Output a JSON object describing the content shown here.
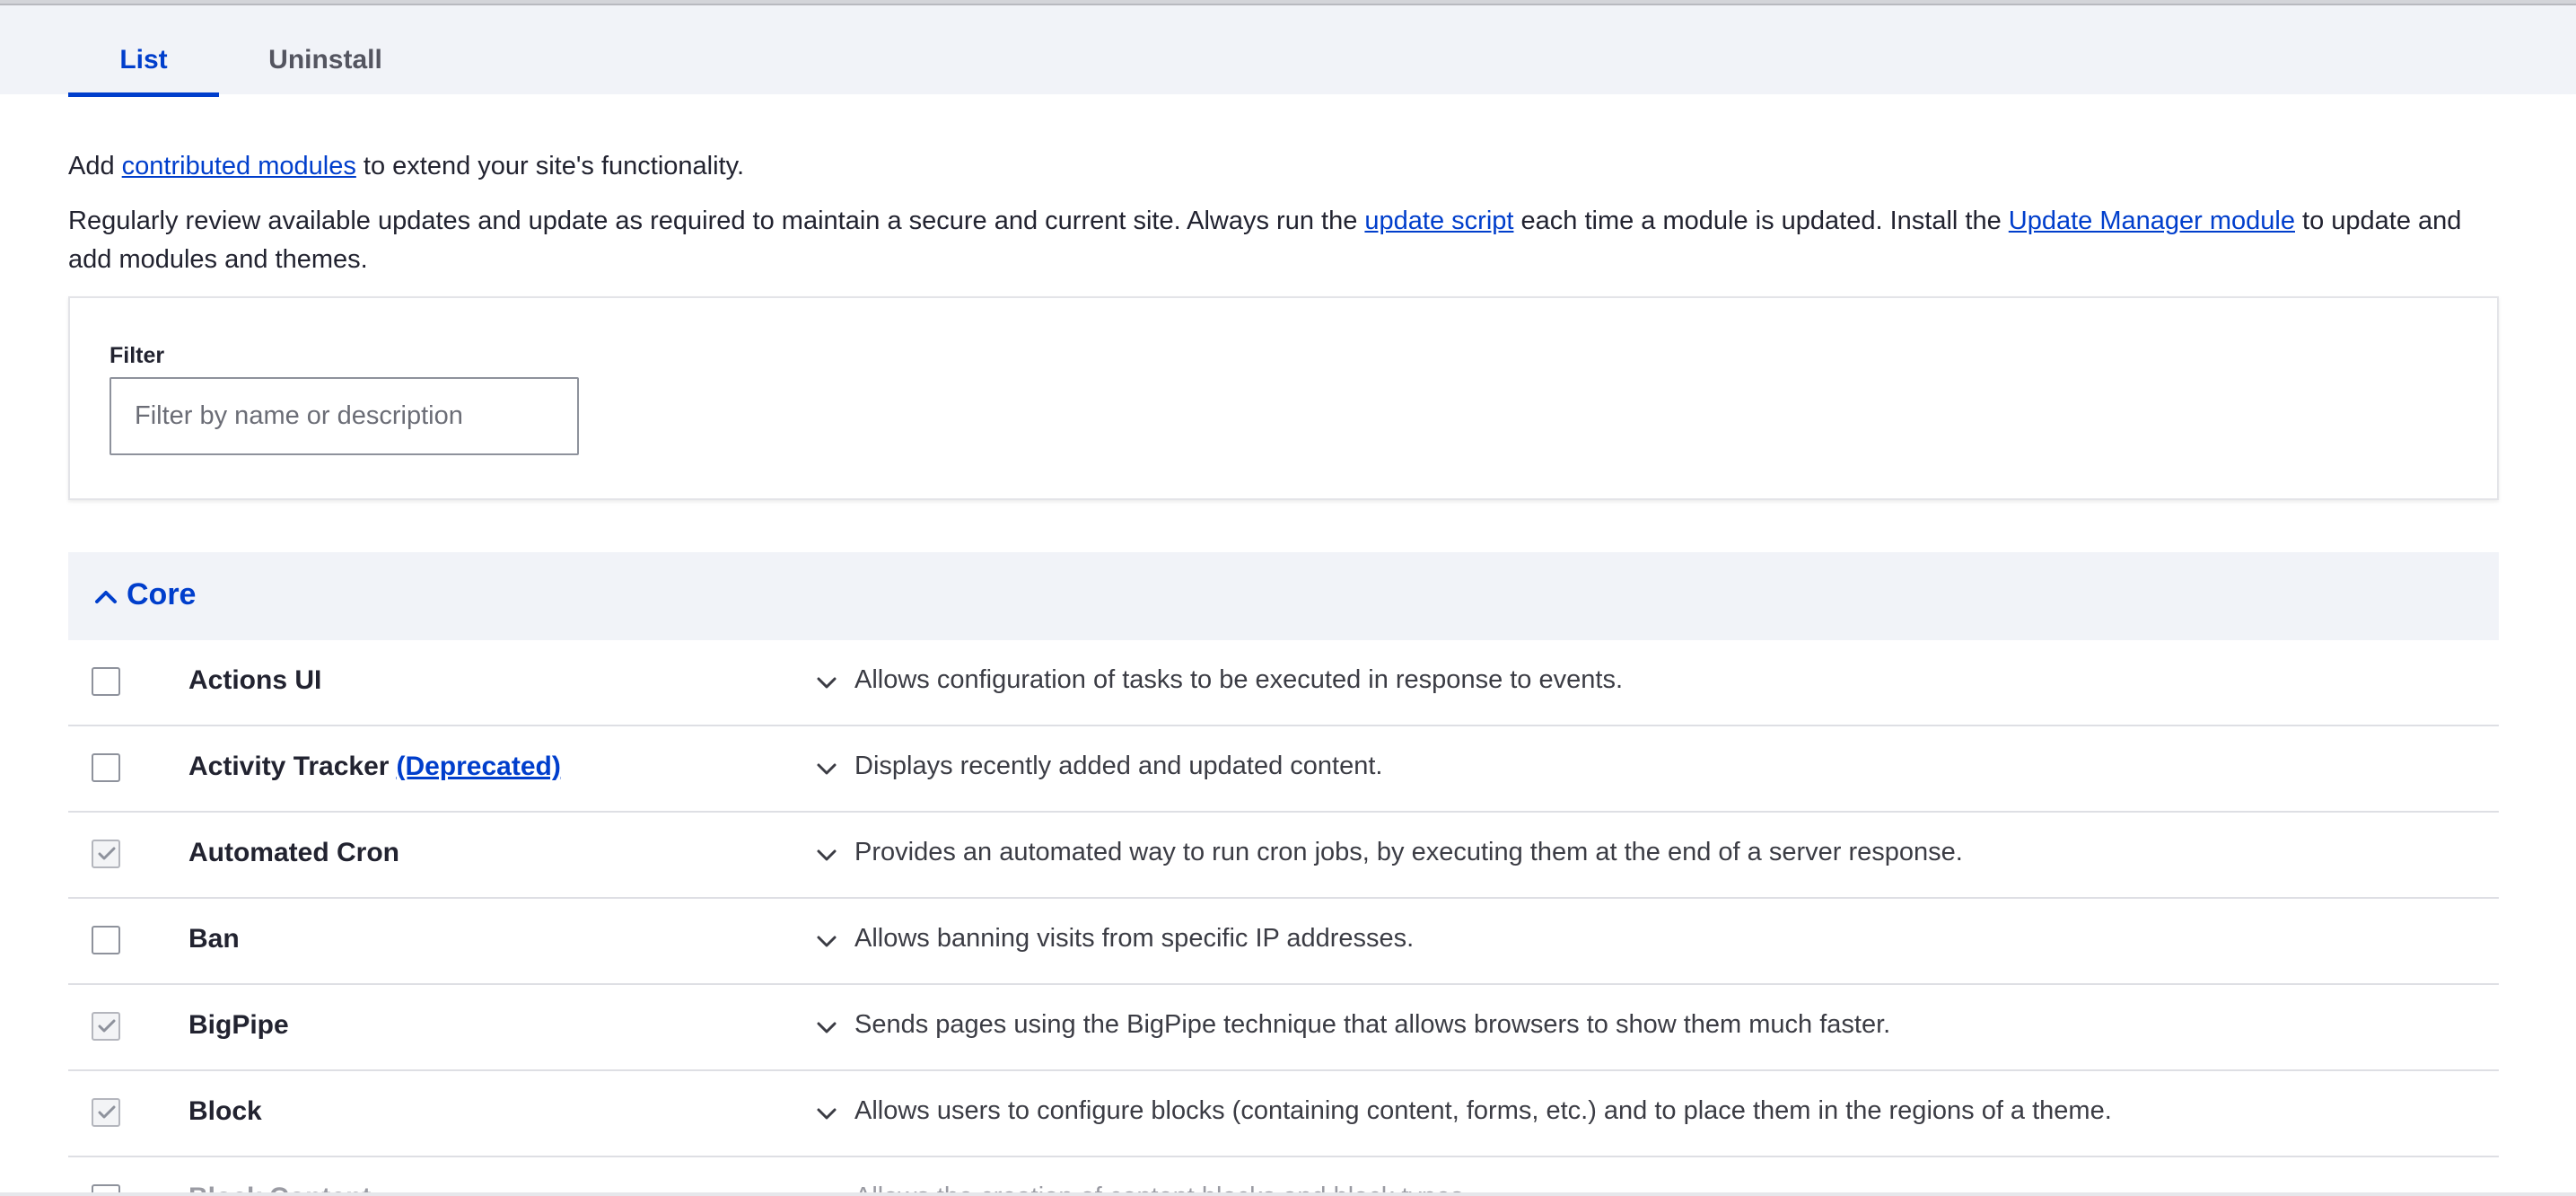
{
  "tabs": [
    {
      "label": "List",
      "active": true
    },
    {
      "label": "Uninstall",
      "active": false
    }
  ],
  "intro": {
    "prefix": "Add ",
    "link": "contributed modules",
    "suffix": " to extend your site's functionality."
  },
  "review": {
    "part1": "Regularly review available updates and update as required to maintain a secure and current site. Always run the ",
    "link1": "update script",
    "part2": " each time a module is updated. Install the ",
    "link2": "Update Manager module",
    "part3": " to update and add modules and themes."
  },
  "filter": {
    "label": "Filter",
    "placeholder": "Filter by name or description",
    "value": ""
  },
  "core": {
    "title": "Core",
    "expanded": true
  },
  "modules": [
    {
      "name": "Actions UI",
      "deprecated_label": "",
      "checked": false,
      "description": "Allows configuration of tasks to be executed in response to events."
    },
    {
      "name": "Activity Tracker",
      "deprecated_label": "(Deprecated)",
      "checked": false,
      "description": "Displays recently added and updated content."
    },
    {
      "name": "Automated Cron",
      "deprecated_label": "",
      "checked": true,
      "description": "Provides an automated way to run cron jobs, by executing them at the end of a server response."
    },
    {
      "name": "Ban",
      "deprecated_label": "",
      "checked": false,
      "description": "Allows banning visits from specific IP addresses."
    },
    {
      "name": "BigPipe",
      "deprecated_label": "",
      "checked": true,
      "description": "Sends pages using the BigPipe technique that allows browsers to show them much faster."
    },
    {
      "name": "Block",
      "deprecated_label": "",
      "checked": true,
      "description": "Allows users to configure blocks (containing content, forms, etc.) and to place them in the regions of a theme."
    },
    {
      "name": "Block Content",
      "deprecated_label": "",
      "checked": false,
      "description": "Allows the creation of content blocks and block types."
    }
  ],
  "colors": {
    "accent": "#003ecc",
    "tab_bar_bg": "#f1f3f8",
    "text": "#222330"
  },
  "icons": {
    "core_toggle": "chevron-up-icon",
    "row_toggle": "chevron-down-icon",
    "checked": "checkmark-icon"
  }
}
